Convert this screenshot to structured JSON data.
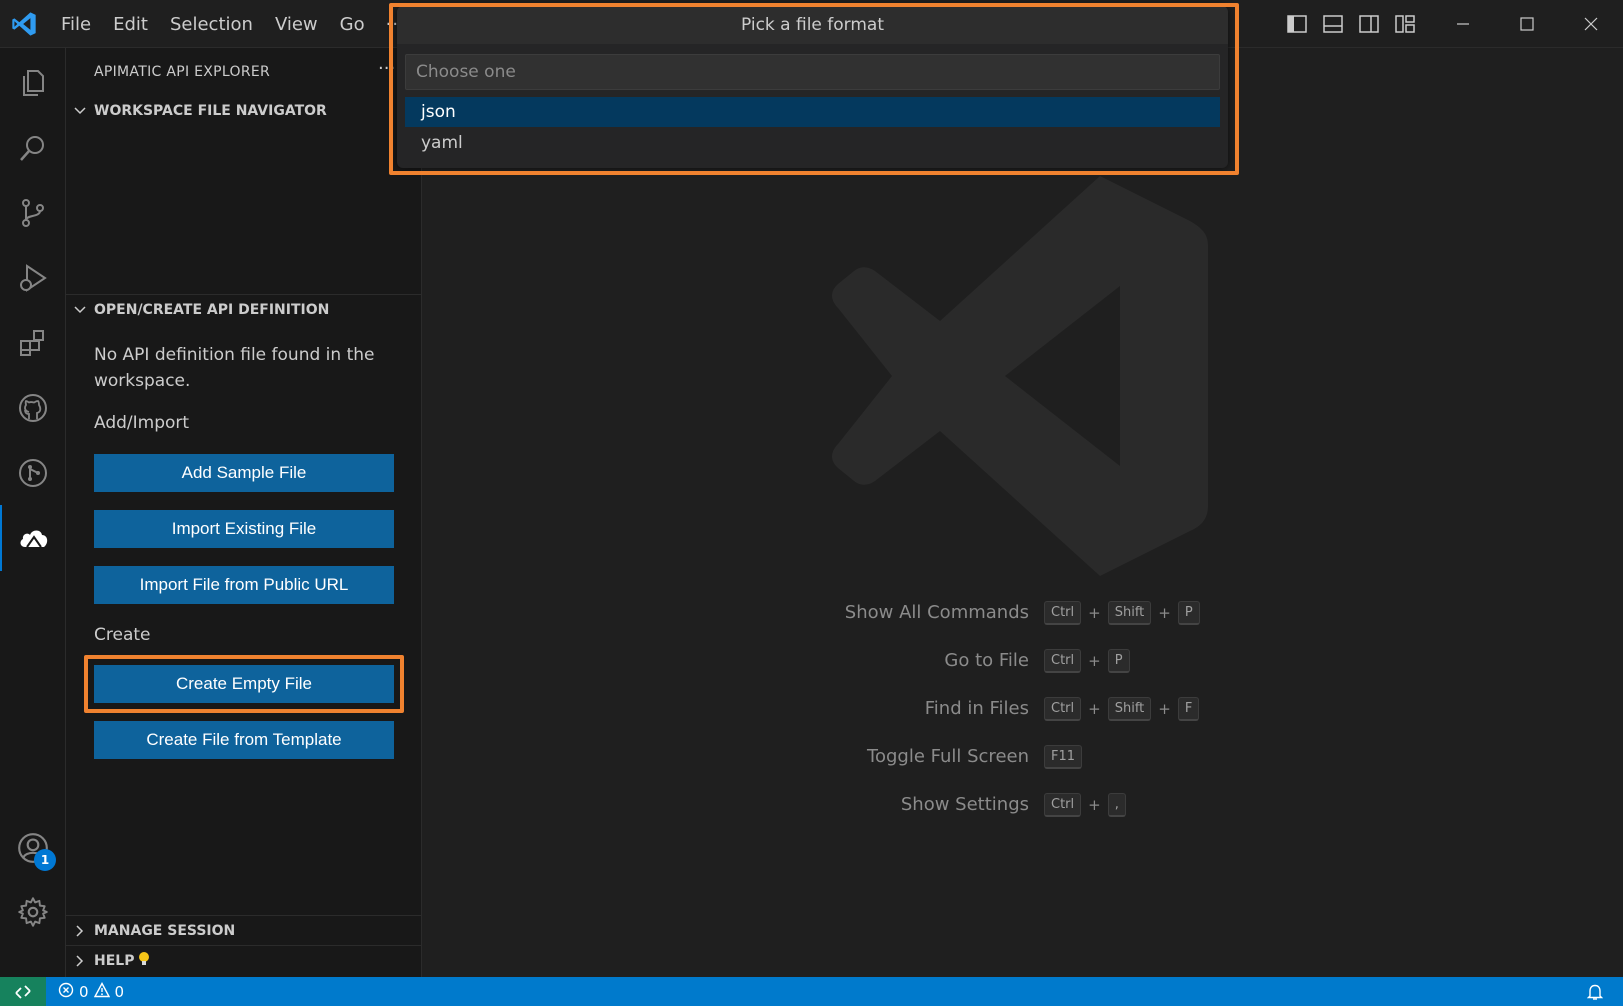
{
  "menu": {
    "items": [
      "File",
      "Edit",
      "Selection",
      "View",
      "Go"
    ],
    "more": "···"
  },
  "sidebar": {
    "title": "APIMATIC API EXPLORER",
    "more": "···",
    "workspace_section": "WORKSPACE FILE NAVIGATOR",
    "api_section": "OPEN/CREATE API DEFINITION",
    "no_file_msg": "No API definition file found in the workspace.",
    "add_import_label": "Add/Import",
    "add_sample_btn": "Add Sample File",
    "import_existing_btn": "Import Existing File",
    "import_url_btn": "Import File from Public URL",
    "create_label": "Create",
    "create_empty_btn": "Create Empty File",
    "create_template_btn": "Create File from Template",
    "manage_session": "MANAGE SESSION",
    "help": "HELP"
  },
  "activity": {
    "accounts_badge": "1"
  },
  "quickpick": {
    "title": "Pick a file format",
    "placeholder": "Choose one",
    "options": [
      "json",
      "yaml"
    ],
    "selected": "json"
  },
  "shortcuts": [
    {
      "label": "Show All Commands",
      "keys": [
        "Ctrl",
        "Shift",
        "P"
      ]
    },
    {
      "label": "Go to File",
      "keys": [
        "Ctrl",
        "P"
      ]
    },
    {
      "label": "Find in Files",
      "keys": [
        "Ctrl",
        "Shift",
        "F"
      ]
    },
    {
      "label": "Toggle Full Screen",
      "keys": [
        "F11"
      ]
    },
    {
      "label": "Show Settings",
      "keys": [
        "Ctrl",
        ","
      ]
    }
  ],
  "status": {
    "errors": "0",
    "warnings": "0"
  },
  "colors": {
    "accent": "#007acc",
    "button": "#0e639c",
    "highlight": "#f0822f",
    "remote": "#16825d"
  }
}
